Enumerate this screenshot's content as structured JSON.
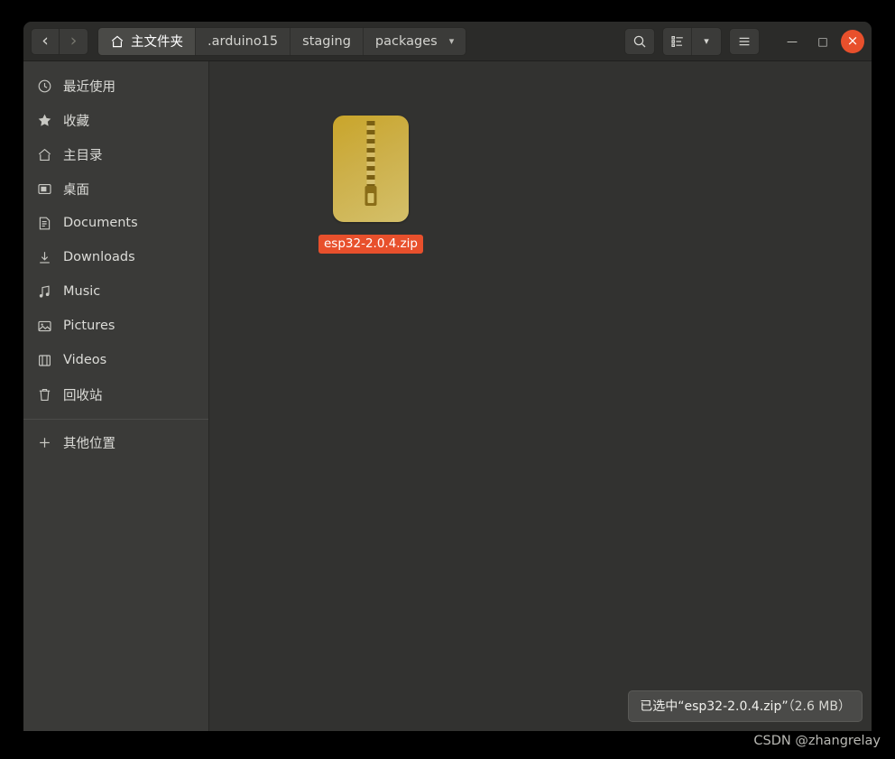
{
  "window": {
    "title": "packages",
    "close_label": "×",
    "minimize_label": "—",
    "maximize_label": "□"
  },
  "nav": {
    "back_label": "‹",
    "forward_label": "›"
  },
  "breadcrumb": {
    "items": [
      {
        "label": "主文件夹",
        "icon": "home-icon",
        "active": true
      },
      {
        "label": ".arduino15",
        "icon": "",
        "active": false
      },
      {
        "label": "staging",
        "icon": "",
        "active": false
      },
      {
        "label": "packages",
        "icon": "",
        "active": false
      }
    ],
    "dropdown_label": "▾"
  },
  "toolbar": {
    "search_icon": "search-icon",
    "view_list_icon": "view-list-icon",
    "view_dropdown_label": "▾",
    "menu_icon": "hamburger-menu-icon"
  },
  "sidebar": {
    "items": [
      {
        "label": "最近使用",
        "icon": "clock-icon"
      },
      {
        "label": "收藏",
        "icon": "star-icon"
      },
      {
        "label": "主目录",
        "icon": "home-icon"
      },
      {
        "label": "桌面",
        "icon": "desktop-icon"
      },
      {
        "label": "Documents",
        "icon": "document-icon"
      },
      {
        "label": "Downloads",
        "icon": "download-icon"
      },
      {
        "label": "Music",
        "icon": "music-note-icon"
      },
      {
        "label": "Pictures",
        "icon": "picture-icon"
      },
      {
        "label": "Videos",
        "icon": "video-icon"
      },
      {
        "label": "回收站",
        "icon": "trash-icon"
      }
    ],
    "other_locations": {
      "label": "其他位置",
      "icon": "plus-icon"
    }
  },
  "content": {
    "files": [
      {
        "name": "esp32-2.0.4.zip",
        "icon": "zip-archive-icon",
        "selected": true
      }
    ]
  },
  "status": {
    "text": "已选中“esp32-2.0.4.zip”",
    "size": "（2.6 MB）"
  },
  "watermark": {
    "text": "CSDN @zhangrelay"
  },
  "colors": {
    "accent": "#e8502c",
    "window_bg": "#323230",
    "headerbar_bg": "#2b2b29",
    "sidebar_bg": "#3a3a38",
    "page_bg": "#000000"
  }
}
